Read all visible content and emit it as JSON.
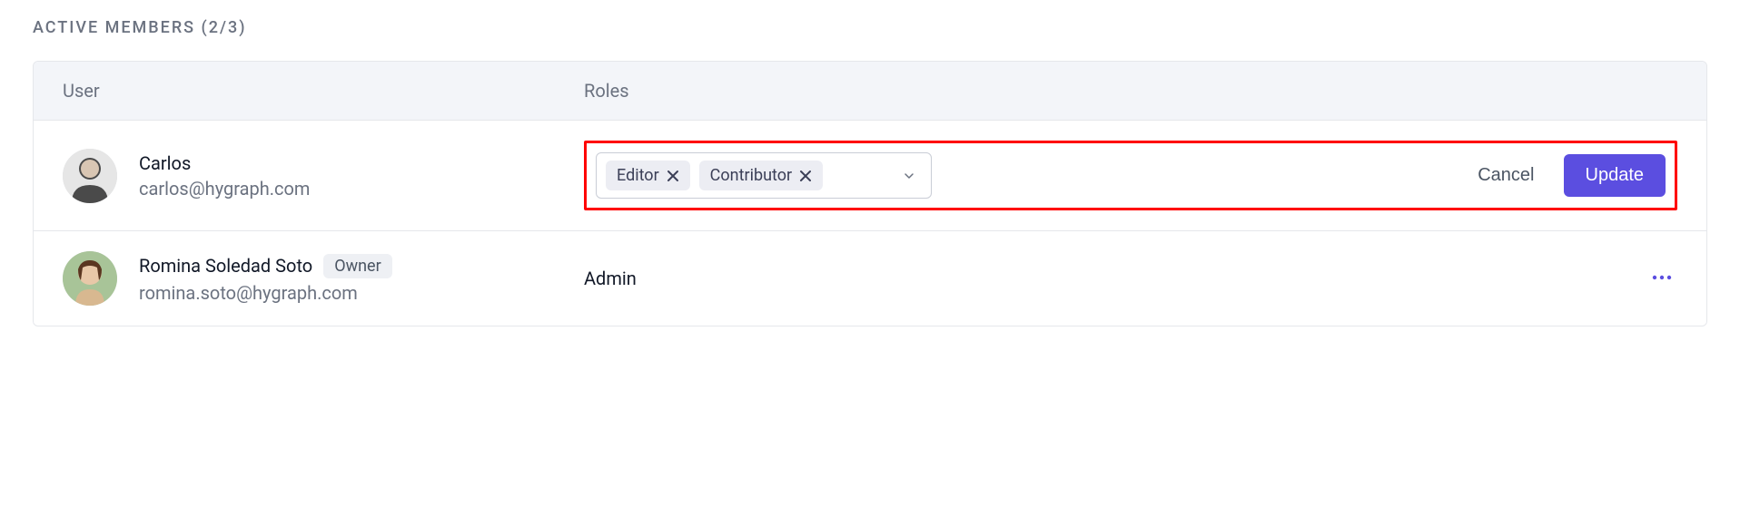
{
  "section_title": "ACTIVE MEMBERS (2/3)",
  "columns": {
    "user": "User",
    "roles": "Roles"
  },
  "members": [
    {
      "name": "Carlos",
      "email": "carlos@hygraph.com",
      "owner": false,
      "editing": true,
      "selected_roles": [
        "Editor",
        "Contributor"
      ],
      "role_text": ""
    },
    {
      "name": "Romina Soledad Soto",
      "email": "romina.soto@hygraph.com",
      "owner": true,
      "editing": false,
      "selected_roles": [],
      "role_text": "Admin"
    }
  ],
  "owner_badge": "Owner",
  "buttons": {
    "cancel": "Cancel",
    "update": "Update"
  },
  "colors": {
    "accent": "#5b4ee0",
    "highlight": "#ff0000"
  }
}
